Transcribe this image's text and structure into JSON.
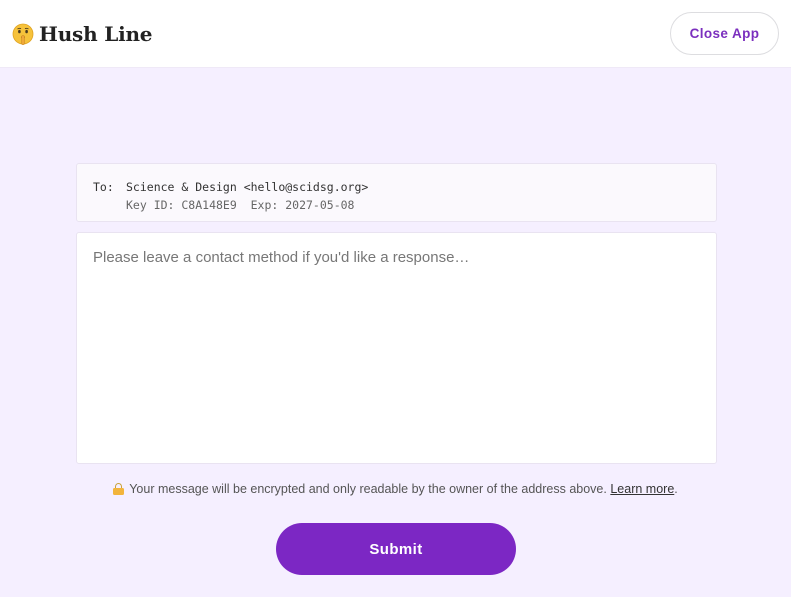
{
  "app": {
    "name": "Hush Line",
    "logo_icon": "shushing-face-emoji-icon"
  },
  "header": {
    "close_label": "Close App"
  },
  "recipient": {
    "to_label": "To:",
    "name_email": "Science & Design <hello@scidsg.org>",
    "key_info": "Key ID: C8A148E9  Exp: 2027-05-08"
  },
  "message": {
    "placeholder": "Please leave a contact method if you'd like a response…",
    "value": ""
  },
  "notice": {
    "icon": "lock-icon",
    "text": "Your message will be encrypted and only readable by the owner of the address above.",
    "link_label": "Learn more",
    "trailing": "."
  },
  "submit": {
    "label": "Submit"
  },
  "colors": {
    "accent": "#7c27c4",
    "page_bg": "#f5efff",
    "header_bg": "#ffffff"
  }
}
